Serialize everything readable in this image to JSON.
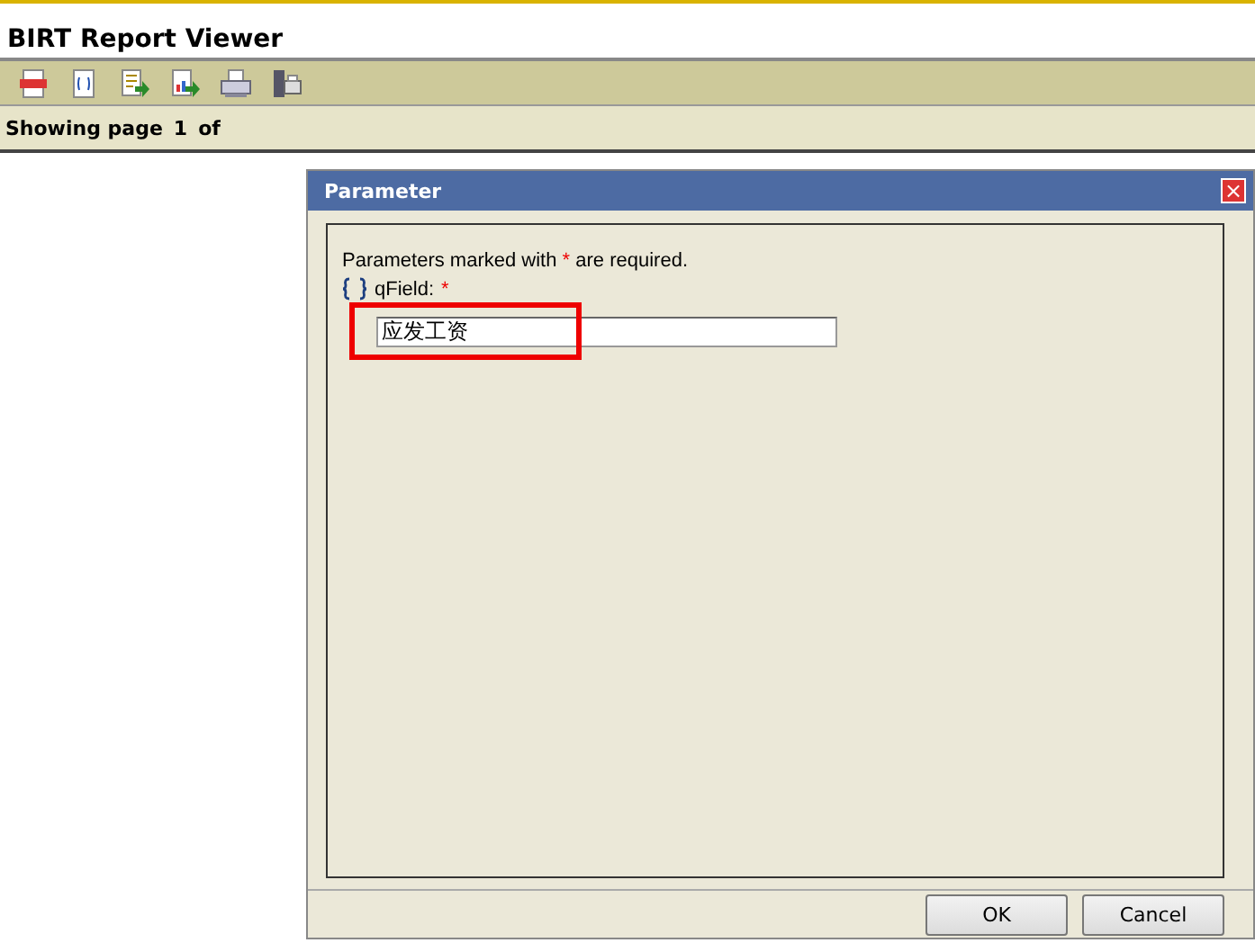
{
  "app_title": "BIRT Report Viewer",
  "toolbar": [
    {
      "kind": "toc"
    },
    {
      "kind": "params"
    },
    {
      "kind": "export"
    },
    {
      "kind": "export_data"
    },
    {
      "kind": "print"
    },
    {
      "kind": "print_server"
    }
  ],
  "status": {
    "label": "Showing page",
    "page": "1",
    "of": "of"
  },
  "dialog": {
    "title": "Parameter",
    "close": "×",
    "note": {
      "before": "Parameters marked with",
      "mark": "*",
      "after": "are required."
    },
    "parameters": [
      {
        "name": "qField:",
        "required": true,
        "value": "应发工资",
        "highlighted": true
      }
    ],
    "buttons": [
      "OK",
      "Cancel"
    ]
  }
}
